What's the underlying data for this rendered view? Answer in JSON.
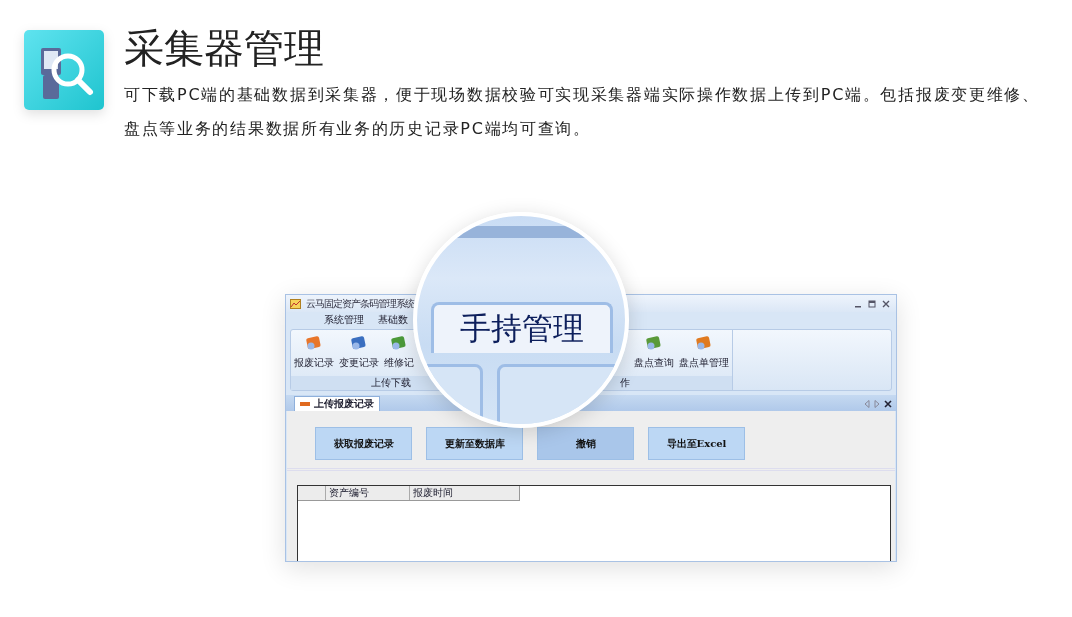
{
  "header": {
    "title": "采集器管理",
    "description": "可下载PC端的基础数据到采集器，便于现场数据校验可实现采集器端实际操作数据上传到PC端。包括报废变更维修、盘点等业务的结果数据所有业务的历史记录PC端均可查询。"
  },
  "window": {
    "title": "云马固定资产条码管理系统",
    "menu": [
      {
        "label": "系统管理"
      },
      {
        "label": "基础数"
      }
    ],
    "ribbon_groups": [
      {
        "label": "上传下载",
        "items": [
          {
            "label": "报废记录"
          },
          {
            "label": "变更记录"
          },
          {
            "label": "维修记"
          }
        ]
      },
      {
        "label": "作",
        "items": [
          {
            "label": "盘点查询"
          },
          {
            "label": "盘点单管理"
          }
        ]
      }
    ],
    "tabs": [
      {
        "label": "上传报废记录",
        "selected": true
      }
    ],
    "buttons": [
      {
        "label": "获取报废记录",
        "pressed": false
      },
      {
        "label": "更新至数据库",
        "pressed": false
      },
      {
        "label": "撤销",
        "pressed": true
      },
      {
        "label": "导出至Excel",
        "pressed": false
      }
    ],
    "grid": {
      "columns": [
        "资产编号",
        "报废时间"
      ]
    }
  },
  "magnifier": {
    "label": "手持管理"
  }
}
